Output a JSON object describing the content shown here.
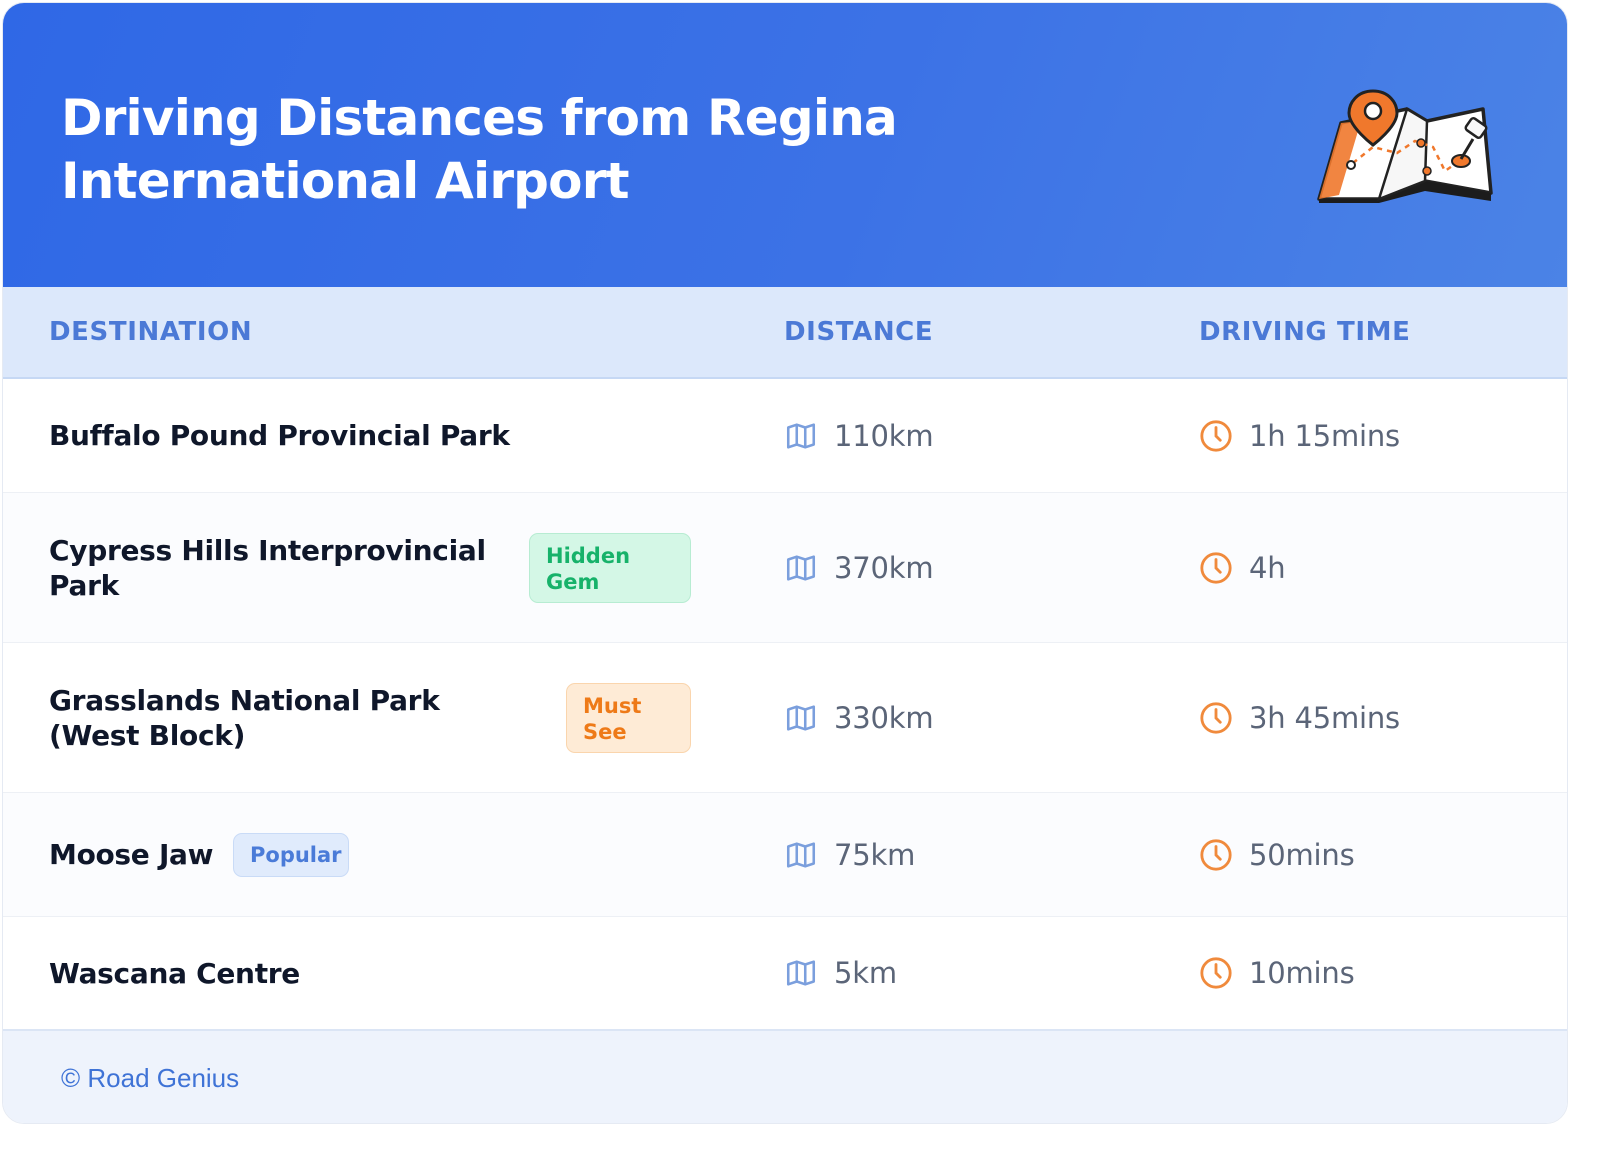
{
  "header": {
    "title": "Driving Distances from Regina International Airport",
    "icon": "map-pin-icon"
  },
  "table": {
    "columns": [
      "DESTINATION",
      "DISTANCE",
      "DRIVING TIME"
    ],
    "rows": [
      {
        "destination": "Buffalo Pound Provincial Park",
        "badge": null,
        "distance": "110km",
        "time": "1h 15mins"
      },
      {
        "destination": "Cypress Hills Interprovincial Park",
        "badge": "Hidden Gem",
        "distance": "370km",
        "time": "4h"
      },
      {
        "destination": "Grasslands National Park (West Block)",
        "badge": "Must See",
        "distance": "330km",
        "time": "3h 45mins"
      },
      {
        "destination": "Moose Jaw",
        "badge": "Popular",
        "distance": "75km",
        "time": "50mins"
      },
      {
        "destination": "Wascana Centre",
        "badge": null,
        "distance": "5km",
        "time": "10mins"
      }
    ],
    "distance_icon": "map-icon",
    "time_icon": "clock-icon"
  },
  "footer": {
    "text": "© Road Genius"
  },
  "colors": {
    "header_gradient_start": "#2f68e6",
    "header_gradient_end": "#4b83e6",
    "column_header_text": "#4b79d6",
    "badge_green": "#17b26a",
    "badge_orange": "#ee7a18",
    "badge_blue": "#4a7bd8",
    "time_icon": "#f08a3c",
    "distance_icon": "#7b9fdd"
  }
}
